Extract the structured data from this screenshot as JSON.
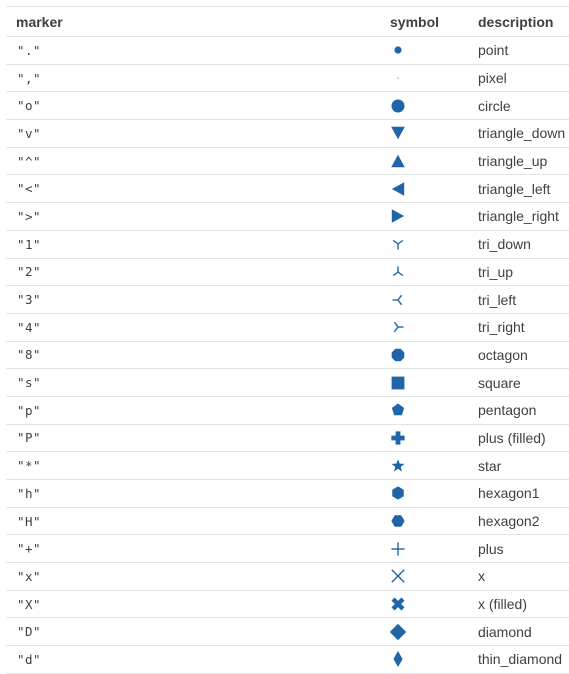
{
  "headers": {
    "marker": "marker",
    "symbol": "symbol",
    "description": "description"
  },
  "symbol_color": "#1f65a8",
  "rows": [
    {
      "marker": "\".\"",
      "icon": "point-icon",
      "description": "point"
    },
    {
      "marker": "\",\"",
      "icon": "pixel-icon",
      "description": "pixel"
    },
    {
      "marker": "\"o\"",
      "icon": "circle-icon",
      "description": "circle"
    },
    {
      "marker": "\"v\"",
      "icon": "triangle-down-icon",
      "description": "triangle_down"
    },
    {
      "marker": "\"^\"",
      "icon": "triangle-up-icon",
      "description": "triangle_up"
    },
    {
      "marker": "\"<\"",
      "icon": "triangle-left-icon",
      "description": "triangle_left"
    },
    {
      "marker": "\">\"",
      "icon": "triangle-right-icon",
      "description": "triangle_right"
    },
    {
      "marker": "\"1\"",
      "icon": "tri-down-icon",
      "description": "tri_down"
    },
    {
      "marker": "\"2\"",
      "icon": "tri-up-icon",
      "description": "tri_up"
    },
    {
      "marker": "\"3\"",
      "icon": "tri-left-icon",
      "description": "tri_left"
    },
    {
      "marker": "\"4\"",
      "icon": "tri-right-icon",
      "description": "tri_right"
    },
    {
      "marker": "\"8\"",
      "icon": "octagon-icon",
      "description": "octagon"
    },
    {
      "marker": "\"s\"",
      "icon": "square-icon",
      "description": "square"
    },
    {
      "marker": "\"p\"",
      "icon": "pentagon-icon",
      "description": "pentagon"
    },
    {
      "marker": "\"P\"",
      "icon": "plus-filled-icon",
      "description": "plus (filled)"
    },
    {
      "marker": "\"*\"",
      "icon": "star-icon",
      "description": "star"
    },
    {
      "marker": "\"h\"",
      "icon": "hexagon1-icon",
      "description": "hexagon1"
    },
    {
      "marker": "\"H\"",
      "icon": "hexagon2-icon",
      "description": "hexagon2"
    },
    {
      "marker": "\"+\"",
      "icon": "plus-icon",
      "description": "plus"
    },
    {
      "marker": "\"x\"",
      "icon": "x-icon",
      "description": "x"
    },
    {
      "marker": "\"X\"",
      "icon": "x-filled-icon",
      "description": "x (filled)"
    },
    {
      "marker": "\"D\"",
      "icon": "diamond-icon",
      "description": "diamond"
    },
    {
      "marker": "\"d\"",
      "icon": "thin-diamond-icon",
      "description": "thin_diamond"
    }
  ]
}
